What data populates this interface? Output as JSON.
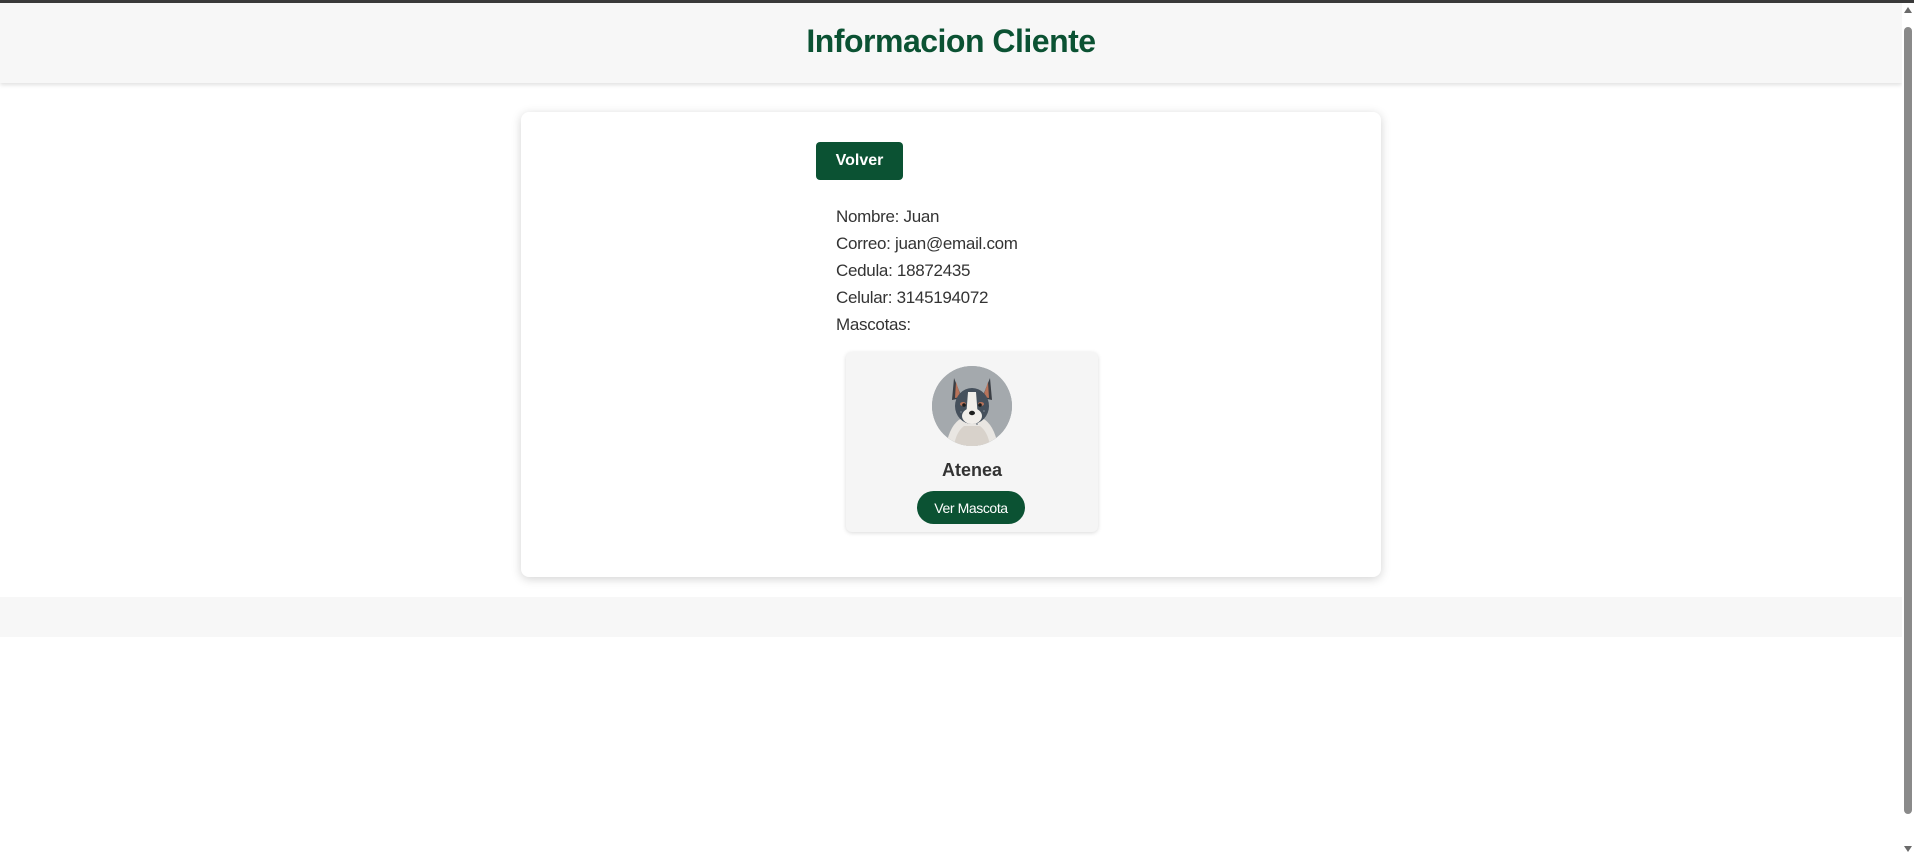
{
  "header": {
    "title": "Informacion Cliente"
  },
  "actions": {
    "back_label": "Volver"
  },
  "client": {
    "name_row": "Nombre: Juan",
    "email_row": "Correo: juan@email.com",
    "id_row": "Cedula: 18872435",
    "phone_row": "Celular: 3145194072",
    "pets_label": "Mascotas:"
  },
  "pets": [
    {
      "name": "Atenea",
      "button_label": "Ver Mascota",
      "avatar_icon": "dog-photo"
    }
  ],
  "colors": {
    "primary": "#0b5233",
    "header_bg": "#f7f7f7",
    "text": "#333333"
  }
}
